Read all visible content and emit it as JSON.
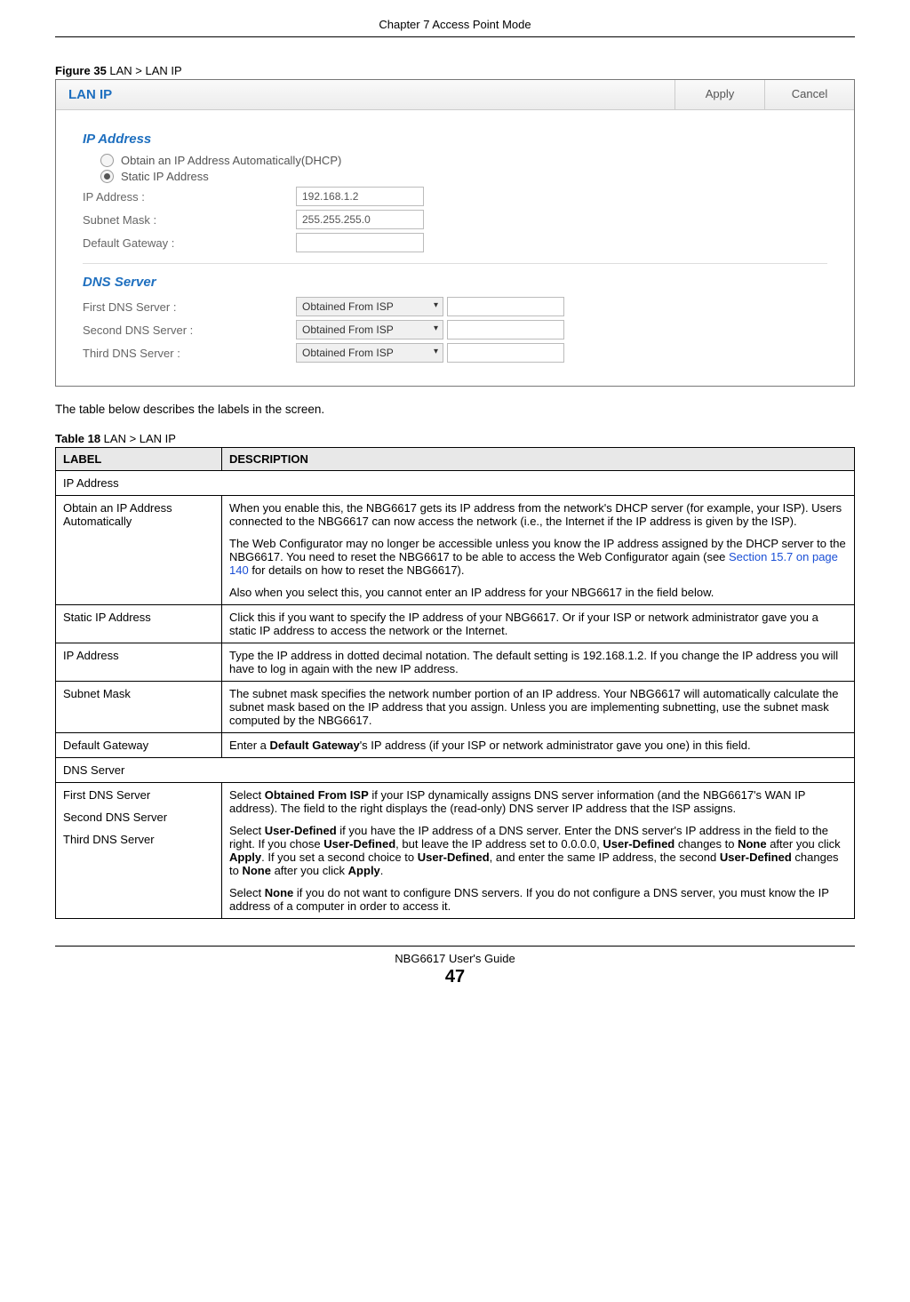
{
  "chapter_header": "Chapter 7 Access Point Mode",
  "figure_caption_bold": "Figure 35",
  "figure_caption_rest": "   LAN > LAN IP",
  "screenshot": {
    "title": "LAN IP",
    "apply_btn": "Apply",
    "cancel_btn": "Cancel",
    "section_ip": "IP Address",
    "radio_dhcp": "Obtain an IP Address Automatically(DHCP)",
    "radio_static": "Static IP Address",
    "label_ip": "IP Address :",
    "value_ip": "192.168.1.2",
    "label_mask": "Subnet Mask :",
    "value_mask": "255.255.255.0",
    "label_gateway": "Default Gateway :",
    "value_gateway": "",
    "section_dns": "DNS Server",
    "label_dns1": "First DNS Server :",
    "label_dns2": "Second DNS Server :",
    "label_dns3": "Third DNS Server :",
    "dns_select": "Obtained From ISP"
  },
  "body_text": "The table below describes the labels in the screen.",
  "table_caption_bold": "Table 18",
  "table_caption_rest": "   LAN > LAN IP",
  "table_headers": {
    "label": "LABEL",
    "desc": "DESCRIPTION"
  },
  "rows": {
    "ip_section": "IP Address",
    "obtain_label": "Obtain an IP Address Automatically",
    "obtain_desc_p1": "When you enable this, the NBG6617 gets its IP address from the network's DHCP server (for example, your ISP). Users connected to the NBG6617 can now access the network (i.e., the Internet if the IP address is given by the ISP).",
    "obtain_desc_p2a": "The Web Configurator may no longer be accessible unless you know the IP address assigned by the DHCP server to the NBG6617. You need to reset the NBG6617 to be able to access the Web Configurator again (see ",
    "obtain_desc_link": "Section 15.7 on page 140",
    "obtain_desc_p2b": " for details on how to reset the NBG6617).",
    "obtain_desc_p3": "Also when you select this, you cannot enter an IP address for your NBG6617 in the field below.",
    "static_label": "Static IP Address",
    "static_desc": "Click this if you want to specify the IP address of your NBG6617. Or if your ISP or network administrator gave you a static IP address to access the network or the Internet.",
    "ipaddr_label": "IP Address",
    "ipaddr_desc": "Type the IP address in dotted decimal notation. The default setting is 192.168.1.2. If you change the IP address you will have to log in again with the new IP address.",
    "subnet_label": "Subnet Mask",
    "subnet_desc": "The subnet mask specifies the network number portion of an IP address. Your NBG6617 will automatically calculate the subnet mask based on the IP address that you assign. Unless you are implementing subnetting, use the subnet mask computed by the NBG6617.",
    "gateway_label": "Default Gateway",
    "gateway_desc_a": "Enter a ",
    "gateway_desc_bold": "Default Gateway",
    "gateway_desc_b": "'s IP address (if your ISP or network administrator gave you one) in this field.",
    "dns_section": "DNS Server",
    "dns_label1": "First DNS Server",
    "dns_label2": "Second DNS Server",
    "dns_label3": "Third DNS Server",
    "dns_p1a": "Select ",
    "dns_p1_bold1": "Obtained From ISP",
    "dns_p1b": " if your ISP dynamically assigns DNS server information (and the NBG6617's WAN IP address). The field to the right displays the (read-only) DNS server IP address that the ISP assigns.",
    "dns_p2a": "Select ",
    "dns_p2_b1": "User-Defined",
    "dns_p2b": " if you have the IP address of a DNS server. Enter the DNS server's IP address in the field to the right. If you chose ",
    "dns_p2_b2": "User-Defined",
    "dns_p2c": ", but leave the IP address set to 0.0.0.0, ",
    "dns_p2_b3": "User-Defined",
    "dns_p2d": " changes to ",
    "dns_p2_b4": "None",
    "dns_p2e": " after you click ",
    "dns_p2_b5": "Apply",
    "dns_p2f": ". If you set a second choice to ",
    "dns_p2_b6": "User-Defined",
    "dns_p2g": ", and enter the same IP address, the second ",
    "dns_p2_b7": "User-Defined",
    "dns_p2h": " changes to ",
    "dns_p2_b8": "None",
    "dns_p2i": " after you click ",
    "dns_p2_b9": "Apply",
    "dns_p2j": ".",
    "dns_p3a": "Select ",
    "dns_p3_b1": "None",
    "dns_p3b": " if you do not want to configure DNS servers. If you do not configure a DNS server, you must know the IP address of a computer in order to access it."
  },
  "footer_text": "NBG6617 User's Guide",
  "page_number": "47"
}
